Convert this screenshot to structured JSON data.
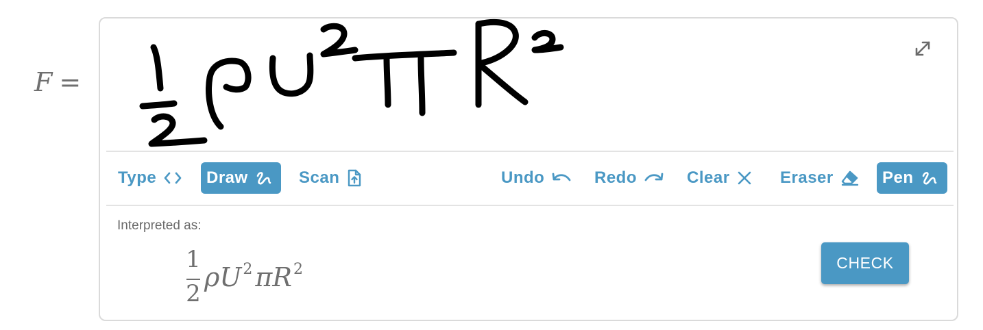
{
  "equation": {
    "lhs_var": "F",
    "lhs_equals": "="
  },
  "canvas": {
    "expand_icon": "expand-arrows-icon",
    "strokes_color": "#000000"
  },
  "toolbar": {
    "type_label": "Type",
    "draw_label": "Draw",
    "scan_label": "Scan",
    "undo_label": "Undo",
    "redo_label": "Redo",
    "clear_label": "Clear",
    "eraser_label": "Eraser",
    "pen_label": "Pen",
    "active_mode": "Draw",
    "active_tool": "Pen"
  },
  "interpretation": {
    "label": "Interpreted as:",
    "frac_num": "1",
    "frac_den": "2",
    "rho": "ρ",
    "u": "U",
    "u_exp": "2",
    "pi": "π",
    "r": "R",
    "r_exp": "2"
  },
  "actions": {
    "check_label": "CHECK"
  },
  "colors": {
    "accent": "#4a98c4",
    "border": "#dadada",
    "text_muted": "#6f6f6f"
  }
}
